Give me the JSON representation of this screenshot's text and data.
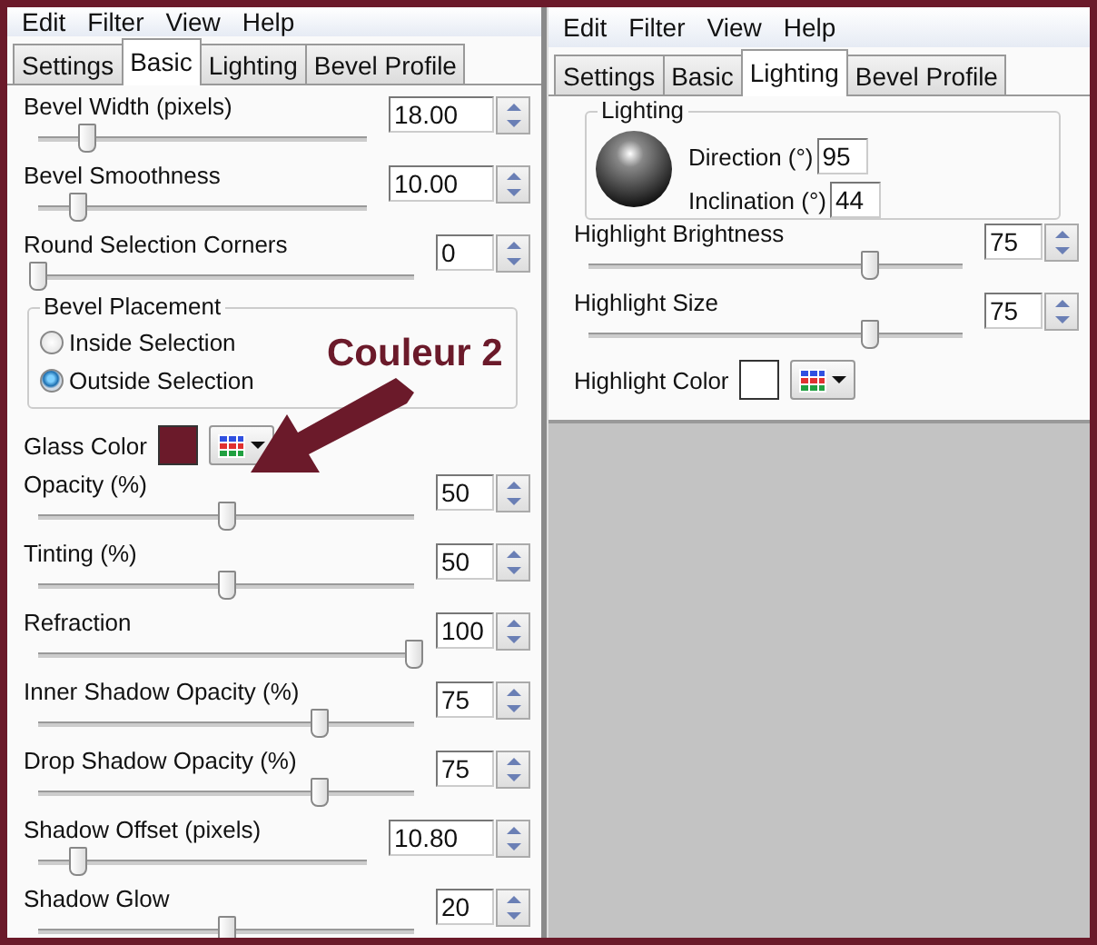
{
  "left": {
    "menu": [
      "Edit",
      "Filter",
      "View",
      "Help"
    ],
    "tabs": [
      {
        "label": "Settings",
        "selected": false
      },
      {
        "label": "Basic",
        "selected": true
      },
      {
        "label": "Lighting",
        "selected": false
      },
      {
        "label": "Bevel Profile",
        "selected": false
      }
    ],
    "controls": [
      {
        "kind": "slider",
        "label": "Bevel Width (pixels)",
        "value": "18.00",
        "level": 0.15
      },
      {
        "kind": "slider",
        "label": "Bevel Smoothness",
        "value": "10.00",
        "level": 0.12
      },
      {
        "kind": "slider",
        "label": "Round Selection Corners",
        "value": "0",
        "level": 0
      },
      {
        "kind": "group",
        "title": "Bevel Placement",
        "options": [
          {
            "label": "Inside Selection",
            "selected": false
          },
          {
            "label": "Outside Selection",
            "selected": true
          }
        ]
      },
      {
        "kind": "color",
        "label": "Glass Color",
        "color": "#6b1a2a"
      },
      {
        "kind": "slider",
        "label": "Opacity (%)",
        "value": "50",
        "level": 0.5
      },
      {
        "kind": "slider",
        "label": "Tinting (%)",
        "value": "50",
        "level": 0.5
      },
      {
        "kind": "slider",
        "label": "Refraction",
        "value": "100",
        "level": 1
      },
      {
        "kind": "slider",
        "label": "Inner Shadow Opacity (%)",
        "value": "75",
        "level": 0.75
      },
      {
        "kind": "slider",
        "label": "Drop Shadow Opacity (%)",
        "value": "75",
        "level": 0.75
      },
      {
        "kind": "slider",
        "label": "Shadow Offset (pixels)",
        "value": "10.80",
        "level": 0.12
      },
      {
        "kind": "slider",
        "label": "Shadow Glow",
        "value": "20",
        "level": 0.5
      }
    ]
  },
  "right": {
    "menu": [
      "Edit",
      "Filter",
      "View",
      "Help"
    ],
    "tabs": [
      {
        "label": "Settings",
        "selected": false
      },
      {
        "label": "Basic",
        "selected": false
      },
      {
        "label": "Lighting",
        "selected": true
      },
      {
        "label": "Bevel Profile",
        "selected": false
      }
    ],
    "controls": [
      {
        "kind": "lighting",
        "title": "Lighting",
        "fields": [
          {
            "label": "Direction (°)",
            "value": "95"
          },
          {
            "label": "Inclination (°)",
            "value": "44"
          }
        ]
      },
      {
        "kind": "slider",
        "label": "Highlight Brightness",
        "value": "75",
        "level": 0.75
      },
      {
        "kind": "slider",
        "label": "Highlight Size",
        "value": "75",
        "level": 0.75
      },
      {
        "kind": "color",
        "label": "Highlight Color",
        "color": "#ffffff"
      }
    ]
  },
  "annotation": {
    "text": "Couleur 2"
  }
}
